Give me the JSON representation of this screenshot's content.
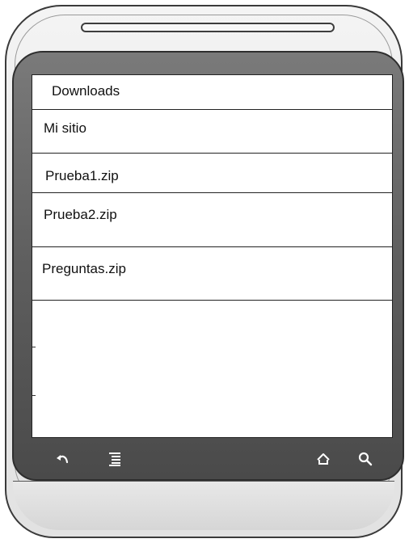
{
  "header": {
    "title": "Downloads"
  },
  "items": [
    {
      "label": "Mi sitio"
    },
    {
      "label": "Prueba1.zip"
    },
    {
      "label": "Prueba2.zip"
    },
    {
      "label": "Preguntas.zip"
    }
  ],
  "navbar": {
    "buttons": [
      {
        "icon": "back-icon"
      },
      {
        "icon": "menu-icon"
      },
      {
        "icon": "home-icon"
      },
      {
        "icon": "search-icon"
      }
    ]
  },
  "colors": {
    "bezel": "#5e5e5e",
    "screen": "#ffffff",
    "body": "#e9e9e9"
  }
}
